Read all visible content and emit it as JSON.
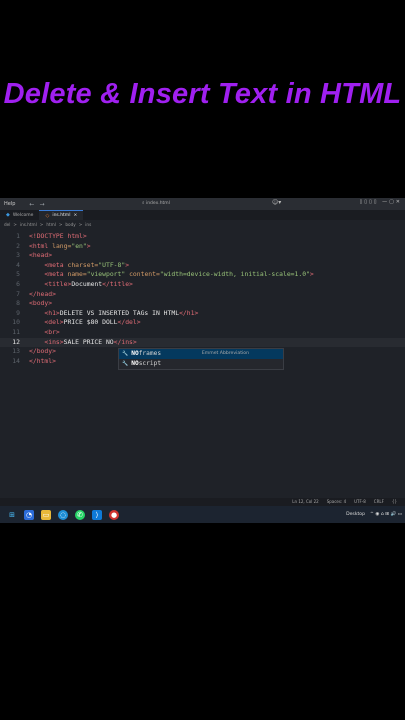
{
  "banner_title": "Delete & Insert Text in HTML",
  "menubar": {
    "help": "Help",
    "search": "index.html",
    "nav_back": "←",
    "nav_fwd": "→"
  },
  "tabs": [
    {
      "label": "Welcome",
      "icon": "vscode-icon"
    },
    {
      "label": "ins.html",
      "icon": "html-file-icon",
      "close": "×"
    }
  ],
  "breadcrumb": [
    "del",
    ">",
    "ins.html",
    ">",
    "html",
    ">",
    "body",
    ">",
    "ins"
  ],
  "code": {
    "line_numbers": [
      "1",
      "2",
      "3",
      "4",
      "5",
      "6",
      "7",
      "8",
      "9",
      "10",
      "11",
      "12",
      "13",
      "14"
    ],
    "l1": "<!DOCTYPE html>",
    "l2_tag": "<html",
    "l2_attr": " lang=",
    "l2_val": "\"en\"",
    "l2_end": ">",
    "l3": "<head>",
    "l4_tag": "<meta",
    "l4_attr": " charset=",
    "l4_val": "\"UTF-8\"",
    "l4_end": ">",
    "l5_tag": "<meta",
    "l5_attr1": " name=",
    "l5_val1": "\"viewport\"",
    "l5_attr2": " content=",
    "l5_val2": "\"width=device-width, initial-scale=1.0\"",
    "l5_end": ">",
    "l6_open": "<title>",
    "l6_text": "Document",
    "l6_close": "</title>",
    "l7": "</head>",
    "l8": "<body>",
    "l9_open": "<h1>",
    "l9_text": "DELETE VS INSERTED TAGs IN HTML",
    "l9_close": "</h1>",
    "l10_open": "<del>",
    "l10_text": "PRICE $80 DOLL",
    "l10_close": "</del>",
    "l11": "<br>",
    "l12_open": "<ins>",
    "l12_text": "SALE PRICE NO",
    "l12_close": "</ins>",
    "l13": "</body>",
    "l14": "</html>"
  },
  "suggestions": [
    {
      "match": "NO",
      "rest": "frames",
      "detail": "Emmet Abbreviation",
      "icon": "wrench-icon"
    },
    {
      "match": "NO",
      "rest": "script",
      "detail": "",
      "icon": "wrench-icon"
    }
  ],
  "statusbar": {
    "position": "Ln 12, Col 22",
    "spaces": "Spaces: 4",
    "encoding": "UTF-8",
    "eol": "CRLF",
    "brackets": "{}"
  },
  "taskbar": {
    "desktop": "Desktop",
    "tray": "^ ◉ ⌂ ⊞ 🔊 ▭"
  }
}
